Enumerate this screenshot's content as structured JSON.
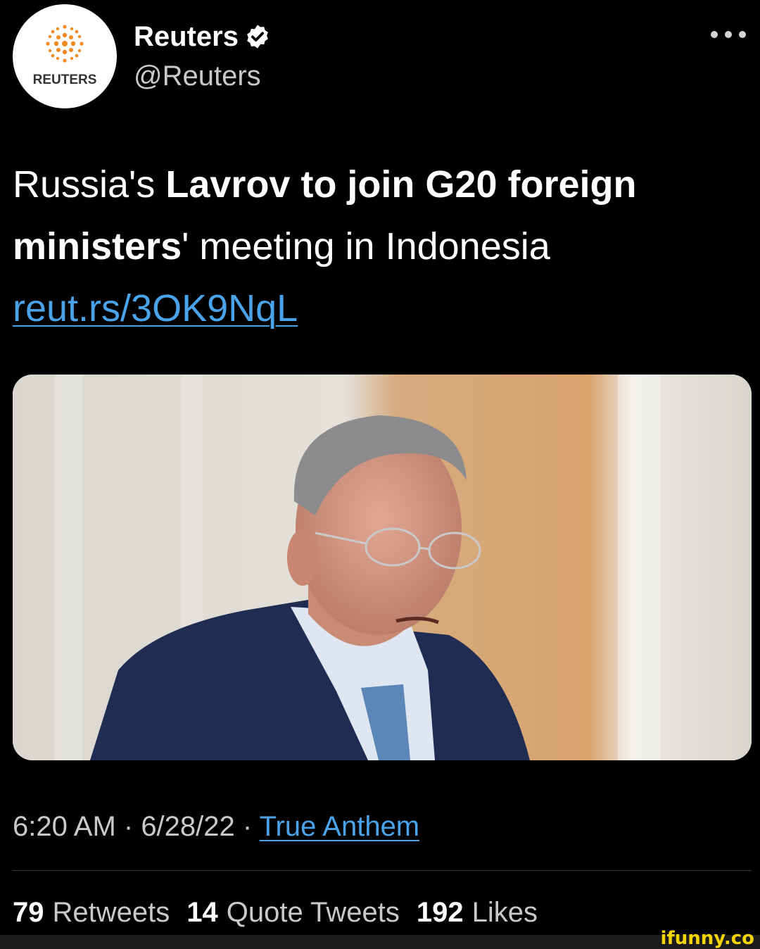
{
  "account": {
    "display_name": "Reuters",
    "handle": "@Reuters",
    "avatar_text": "REUTERS",
    "verified": true
  },
  "tweet": {
    "text_parts": [
      {
        "text": "Russia's ",
        "bold": false
      },
      {
        "text": "Lavrov to join G20 foreign ministers",
        "bold": true
      },
      {
        "text": "' meeting in Indonesia ",
        "bold": false
      }
    ],
    "link": "reut.rs/3OK9NqL",
    "image_alt": "Photo of Sergei Lavrov"
  },
  "meta": {
    "time": "6:20 AM",
    "separator": " · ",
    "date": "6/28/22",
    "source": "True Anthem"
  },
  "stats": {
    "retweets_count": "79",
    "retweets_label": "Retweets",
    "quotes_count": "14",
    "quotes_label": "Quote Tweets",
    "likes_count": "192",
    "likes_label": "Likes"
  },
  "watermark": "ifunny.co",
  "colors": {
    "background": "#000000",
    "link": "#4aa3e8",
    "muted_text": "#c9c9c9",
    "reuters_orange": "#f08a24"
  }
}
